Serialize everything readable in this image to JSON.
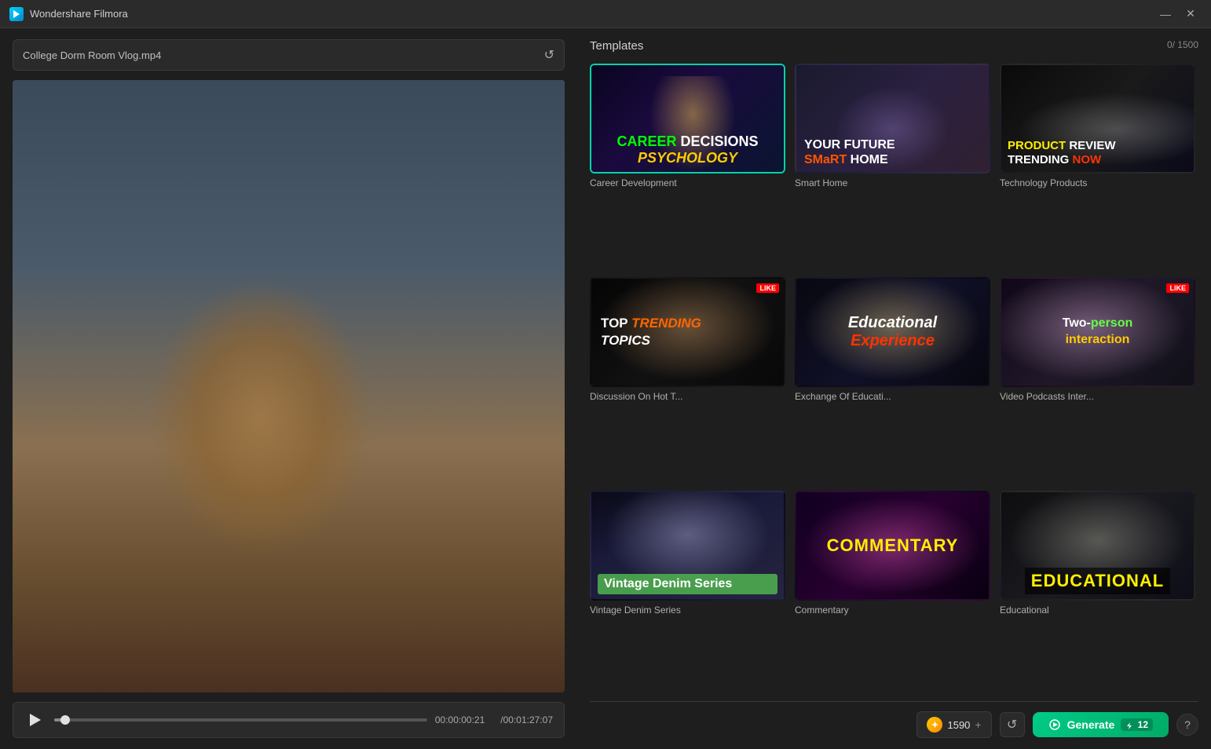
{
  "app": {
    "title": "Wondershare Filmora",
    "min_label": "—",
    "close_label": "✕"
  },
  "file_bar": {
    "filename": "College Dorm Room Vlog.mp4",
    "placeholder": "College Dorm Room Vlog.mp4"
  },
  "video": {
    "current_time": "00:00:00:21",
    "total_time": "/00:01:27:07",
    "progress_percent": 3
  },
  "right": {
    "counter": "0/ 1500",
    "templates_title": "Templates",
    "generate_label": "Generate",
    "generate_count": "12",
    "credits_value": "1590",
    "help_symbol": "?"
  },
  "templates": [
    {
      "id": "career-development",
      "label": "Career Development",
      "style": "tmpl-career",
      "selected": true,
      "overlay_type": "career"
    },
    {
      "id": "smart-home",
      "label": "Smart Home",
      "style": "tmpl-smarthome",
      "selected": false,
      "overlay_type": "smarthome"
    },
    {
      "id": "technology-products",
      "label": "Technology Products",
      "style": "tmpl-techproducts",
      "selected": false,
      "overlay_type": "techproducts"
    },
    {
      "id": "discussion-hot-topics",
      "label": "Discussion On Hot T...",
      "style": "tmpl-discussion",
      "selected": false,
      "overlay_type": "discussion"
    },
    {
      "id": "exchange-education",
      "label": "Exchange Of Educati...",
      "style": "tmpl-education",
      "selected": false,
      "overlay_type": "education"
    },
    {
      "id": "video-podcasts",
      "label": "Video Podcasts Inter...",
      "style": "tmpl-podcast",
      "selected": false,
      "overlay_type": "podcast"
    },
    {
      "id": "vintage-denim",
      "label": "Vintage Denim Series",
      "style": "tmpl-denim",
      "selected": false,
      "overlay_type": "denim"
    },
    {
      "id": "commentary",
      "label": "Commentary",
      "style": "tmpl-commentary",
      "selected": false,
      "overlay_type": "commentary"
    },
    {
      "id": "educational",
      "label": "Educational",
      "style": "tmpl-educational2",
      "selected": false,
      "overlay_type": "educational2"
    }
  ]
}
